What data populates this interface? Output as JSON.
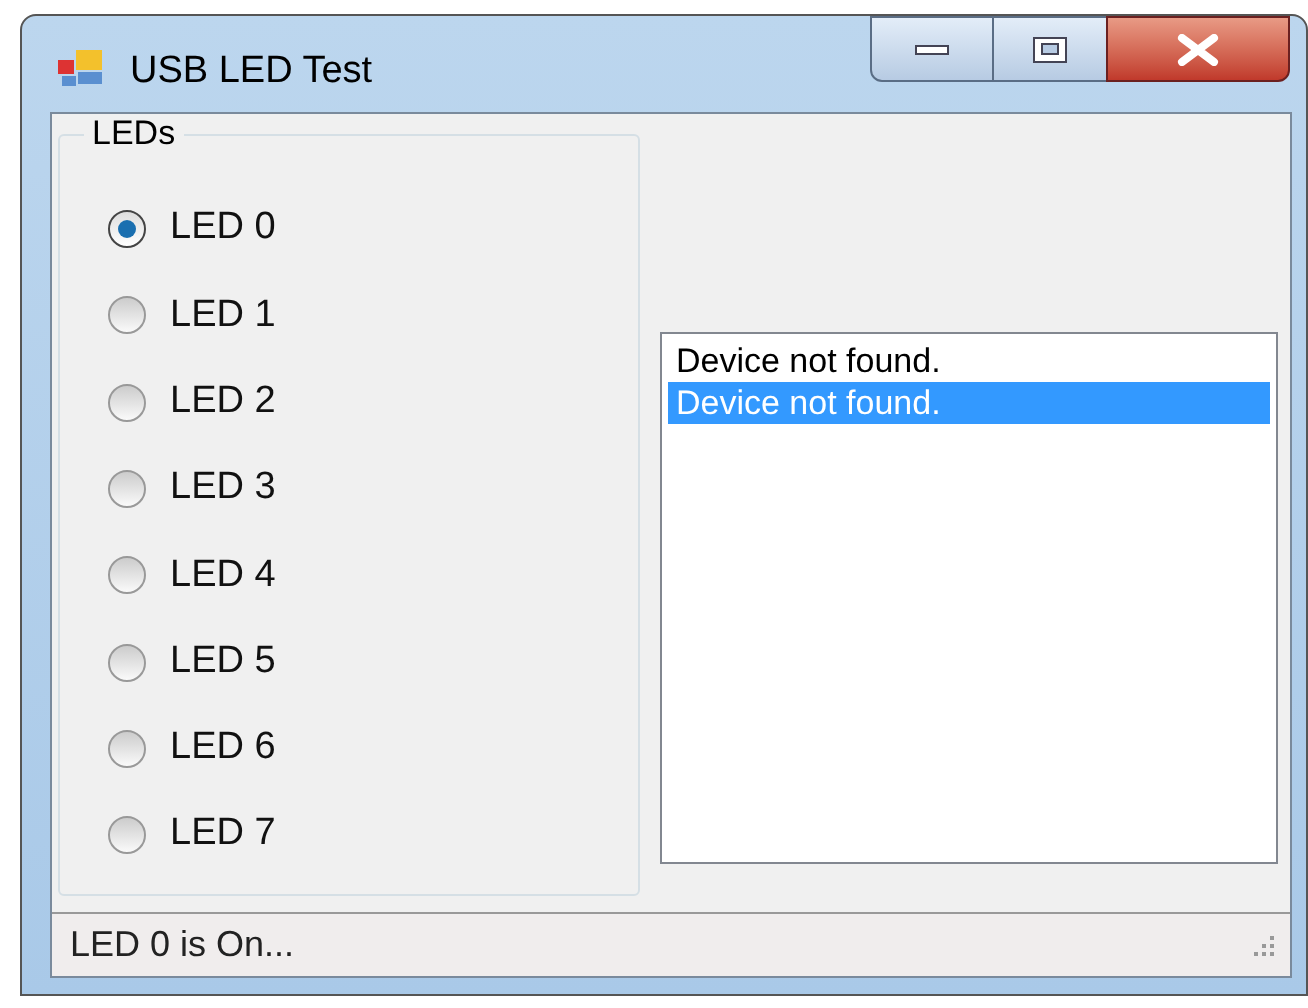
{
  "window": {
    "title": "USB LED Test"
  },
  "group": {
    "title": "LEDs",
    "options": [
      {
        "label": "LED 0",
        "selected": true
      },
      {
        "label": "LED 1",
        "selected": false
      },
      {
        "label": "LED 2",
        "selected": false
      },
      {
        "label": "LED 3",
        "selected": false
      },
      {
        "label": "LED 4",
        "selected": false
      },
      {
        "label": "LED 5",
        "selected": false
      },
      {
        "label": "LED 6",
        "selected": false
      },
      {
        "label": "LED 7",
        "selected": false
      }
    ]
  },
  "log": {
    "items": [
      {
        "text": "Device not found.",
        "selected": false
      },
      {
        "text": "Device not found.",
        "selected": true
      }
    ]
  },
  "status_bar": {
    "text": "LED 0 is On..."
  }
}
